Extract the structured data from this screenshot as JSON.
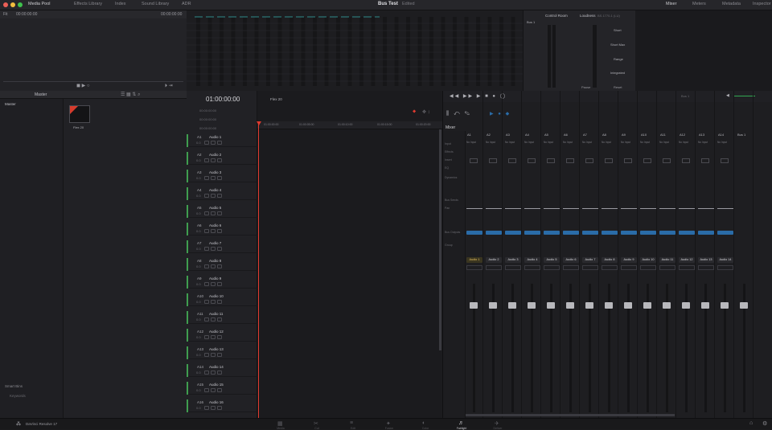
{
  "topbar": {
    "items": [
      "Media Pool",
      "Effects Library",
      "Index",
      "Sound Library",
      "ADR"
    ],
    "right_items": [
      "Mixer",
      "Meters",
      "Metadata",
      "Inspector"
    ],
    "project_title": "Bus Test",
    "project_sub": "Edited"
  },
  "viewer": {
    "zoom": "Fit",
    "timecode_left": "00:00:00:00",
    "timecode_right": "00:00:00:00"
  },
  "mediapool": {
    "title": "Master",
    "sidebar_root": "Master",
    "smart_bins": "Smart Bins",
    "smart_item": "Keywords",
    "clip_name": "Flex 20"
  },
  "timeline": {
    "timecode": "01:00:00:00",
    "name": "Flex 20",
    "subcodes": [
      "00:00:00:00",
      "00:00:00:00",
      "00:00:00:00"
    ],
    "ruler": [
      "01:00:00:00",
      "01:00:05:00",
      "01:00:10:00",
      "01:00:15:00",
      "01:00:20:00"
    ],
    "tracks": [
      {
        "id": "A1",
        "name": "Audio 1"
      },
      {
        "id": "A2",
        "name": "Audio 2"
      },
      {
        "id": "A3",
        "name": "Audio 3"
      },
      {
        "id": "A4",
        "name": "Audio 4"
      },
      {
        "id": "A5",
        "name": "Audio 5"
      },
      {
        "id": "A6",
        "name": "Audio 6"
      },
      {
        "id": "A7",
        "name": "Audio 7"
      },
      {
        "id": "A8",
        "name": "Audio 8"
      },
      {
        "id": "A9",
        "name": "Audio 9"
      },
      {
        "id": "A10",
        "name": "Audio 10"
      },
      {
        "id": "A11",
        "name": "Audio 11"
      },
      {
        "id": "A12",
        "name": "Audio 12"
      },
      {
        "id": "A13",
        "name": "Audio 13"
      },
      {
        "id": "A14",
        "name": "Audio 14"
      },
      {
        "id": "A15",
        "name": "Audio 15"
      },
      {
        "id": "A16",
        "name": "Audio 16"
      }
    ],
    "track_subtext": "0.0"
  },
  "control_room": {
    "title": "Control Room",
    "loudness": "Loudness",
    "loudness_std": "BS.1770-1 (LU)",
    "bus": "Bus 1",
    "labels": [
      "Short",
      "Short Max",
      "Range",
      "Integrated"
    ],
    "pause": "Pause",
    "reset": "Reset"
  },
  "mixer": {
    "title": "Mixer",
    "channels": [
      "A1",
      "A2",
      "A3",
      "A4",
      "A5",
      "A6",
      "A7",
      "A8",
      "A9",
      "A10",
      "A11",
      "A12",
      "A13",
      "A14"
    ],
    "track_names": [
      "Audio 1",
      "Audio 2",
      "Audio 3",
      "Audio 4",
      "Audio 5",
      "Audio 6",
      "Audio 7",
      "Audio 8",
      "Audio 9",
      "Audio 10",
      "Audio 11",
      "Audio 12",
      "Audio 13",
      "Audio 14"
    ],
    "bus_label": "Bus 1",
    "row_labels": [
      "Input",
      "Effects",
      "Insert",
      "EQ",
      "Dynamics",
      "Bus Sends",
      "Pan",
      "Bus Outputs",
      "Group"
    ],
    "input_value": "No Input"
  },
  "bottombar": {
    "app_name": "DaVinci Resolve 17",
    "pages": [
      "Media",
      "Cut",
      "Edit",
      "Fusion",
      "Color",
      "Fairlight",
      "Deliver"
    ],
    "active_page": "Fairlight"
  },
  "colors": {
    "accent_blue": "#2a6ca8",
    "track_green": "#3f9d4f",
    "playhead_red": "#e03a2f",
    "clip_red": "#d63b2c",
    "meter_green": "#32a852"
  }
}
